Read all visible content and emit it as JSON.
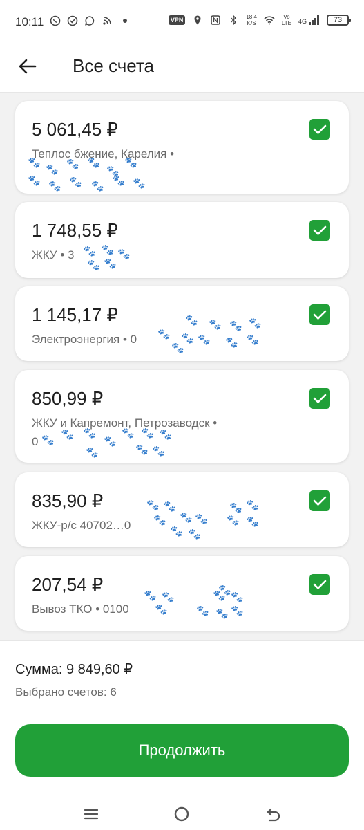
{
  "status_bar": {
    "time": "10:11",
    "vpn": "VPN",
    "speed_value": "18,4",
    "speed_unit": "K/S",
    "volte_top": "Vo",
    "volte_bottom": "LTE",
    "network": "4G",
    "battery": "73"
  },
  "header": {
    "title": "Все счета"
  },
  "accounts": [
    {
      "amount": "5 061,45 ₽",
      "line1": "Теплос  бжение, Карелия •",
      "line2": "",
      "checked": true
    },
    {
      "amount": "1 748,55 ₽",
      "line1": "ЖКУ • 3",
      "line2": "",
      "checked": true
    },
    {
      "amount": "1 145,17 ₽",
      "line1": "Электроэнергия • 0",
      "line2": "",
      "checked": true
    },
    {
      "amount": "850,99 ₽",
      "line1": "ЖКУ и Капремонт, Петрозаводск •",
      "line2": "0",
      "checked": true
    },
    {
      "amount": "835,90 ₽",
      "line1": "ЖКУ-р/с 40702…0",
      "line2": "",
      "checked": true
    },
    {
      "amount": "207,54 ₽",
      "line1": "Вывоз ТКО • 0100",
      "line2": "",
      "checked": true
    }
  ],
  "summary": {
    "total": "Сумма: 9 849,60 ₽",
    "selected_count": "Выбрано счетов: 6"
  },
  "actions": {
    "continue_label": "Продолжить"
  },
  "colors": {
    "accent": "#21a038",
    "background": "#f2f2f2",
    "card": "#ffffff"
  },
  "icons": {
    "back": "arrow-left-icon",
    "checkbox": "checkmark-icon",
    "nav_menu": "menu-icon",
    "nav_home": "home-circle-icon",
    "nav_back": "return-icon"
  }
}
